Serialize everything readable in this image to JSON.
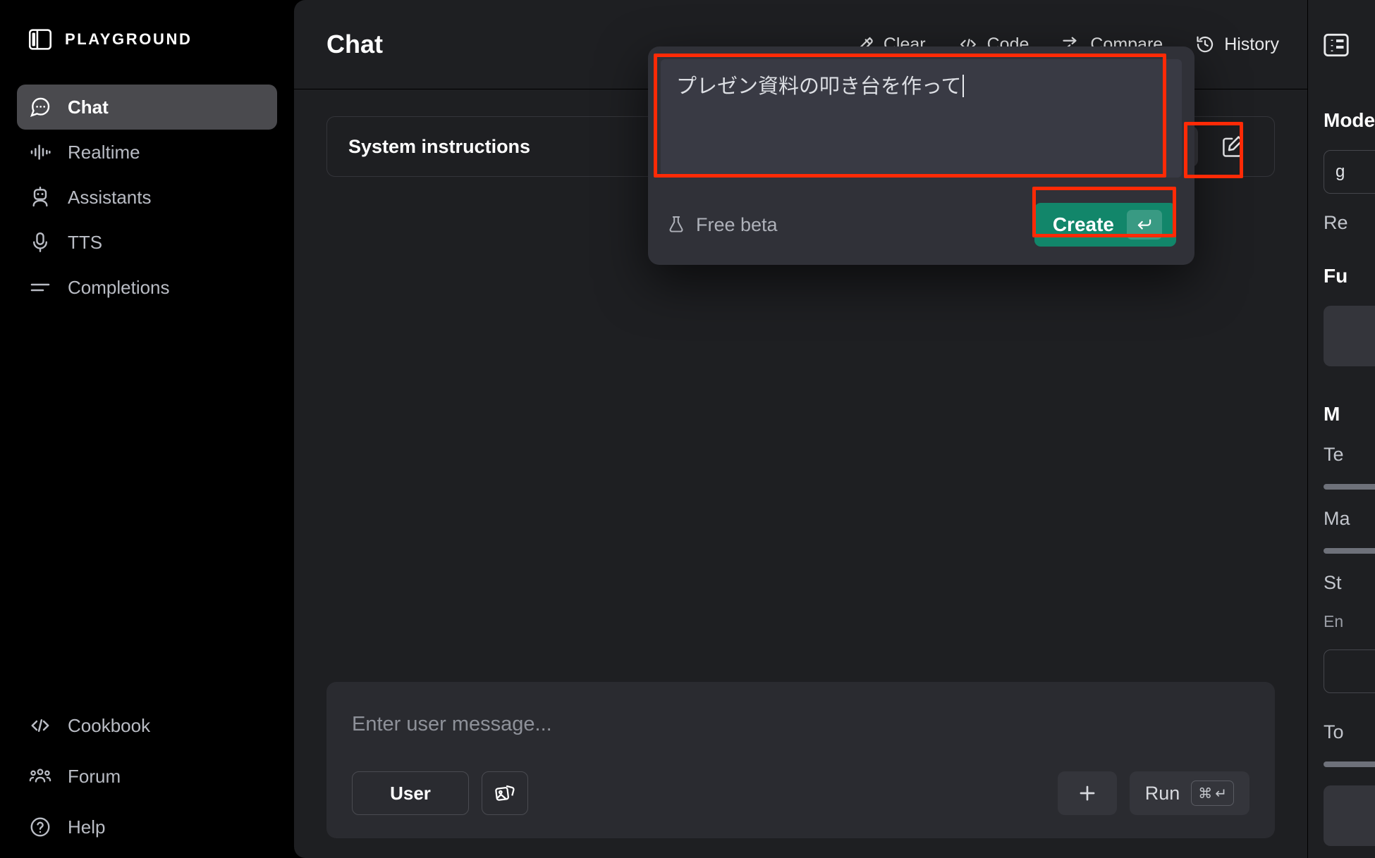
{
  "app": {
    "brand": "PLAYGROUND",
    "brand_icon": "panel-layout-icon"
  },
  "sidebar": {
    "primary_items": [
      {
        "label": "Chat",
        "icon": "chat-bubble-icon",
        "active": true
      },
      {
        "label": "Realtime",
        "icon": "waveform-icon",
        "active": false
      },
      {
        "label": "Assistants",
        "icon": "robot-icon",
        "active": false
      },
      {
        "label": "TTS",
        "icon": "microphone-icon",
        "active": false
      },
      {
        "label": "Completions",
        "icon": "lines-icon",
        "active": false
      }
    ],
    "bottom_items": [
      {
        "label": "Cookbook",
        "icon": "code-brackets-icon"
      },
      {
        "label": "Forum",
        "icon": "people-group-icon"
      },
      {
        "label": "Help",
        "icon": "question-circle-icon"
      }
    ]
  },
  "header": {
    "title": "Chat",
    "actions": [
      {
        "label": "Clear",
        "icon": "eraser-icon"
      },
      {
        "label": "Code",
        "icon": "code-brackets-icon"
      },
      {
        "label": "Compare",
        "icon": "compare-arrows-icon"
      },
      {
        "label": "History",
        "icon": "clock-history-icon"
      }
    ],
    "panel_toggle_icon": "panel-right-icon"
  },
  "system_instructions": {
    "label": "System instructions",
    "generate_icon": "sparkle-icon",
    "edit_icon": "pencil-square-icon"
  },
  "popup": {
    "prompt_text": "プレゼン資料の叩き台を作って",
    "has_caret": true,
    "beta_label": "Free beta",
    "beta_icon": "flask-icon",
    "create_label": "Create",
    "create_kbd": "↵",
    "create_color": "#12866a"
  },
  "composer": {
    "placeholder": "Enter user message...",
    "role_label": "User",
    "attach_icon": "images-icon",
    "add_label": "+",
    "run_label": "Run",
    "run_kbd_cmd": "⌘",
    "run_kbd_enter": "↵"
  },
  "right_panel": {
    "model_section": "Model",
    "model_value": "g",
    "reasoning_label": "Re",
    "functions_section": "Fu",
    "model_config_section": "M",
    "temperature_label": "Te",
    "max_tokens_label": "Ma",
    "stop_label": "St",
    "stop_placeholder": "En",
    "tools_label": "To"
  },
  "annotations": {
    "highlight_color": "#ff2a06",
    "boxes": [
      "prompt-textarea",
      "create-button",
      "sparkle-generate-button"
    ]
  }
}
